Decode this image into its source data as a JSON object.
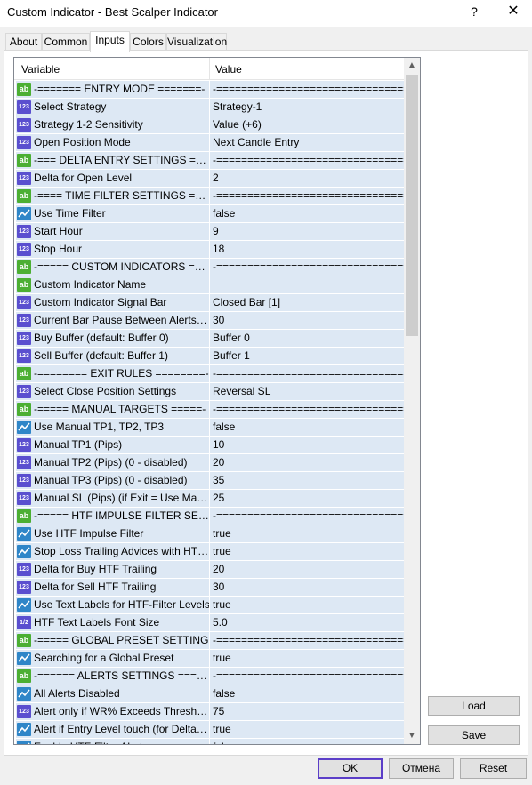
{
  "window": {
    "title": "Custom Indicator - Best Scalper Indicator",
    "help_glyph": "?",
    "close_glyph": "✕"
  },
  "tabs": [
    {
      "label": "About"
    },
    {
      "label": "Common"
    },
    {
      "label": "Inputs",
      "active": true
    },
    {
      "label": "Colors"
    },
    {
      "label": "Visualization"
    }
  ],
  "grid": {
    "header": {
      "variable": "Variable",
      "value": "Value"
    },
    "rows": [
      {
        "type": "ab",
        "variable": "-=======  ENTRY MODE  =======-",
        "value": "-===================================-"
      },
      {
        "type": "123",
        "variable": "Select Strategy",
        "value": "Strategy-1"
      },
      {
        "type": "123",
        "variable": "Strategy 1-2 Sensitivity",
        "value": "Value (+6)"
      },
      {
        "type": "123",
        "variable": "Open Position Mode",
        "value": "Next Candle Entry"
      },
      {
        "type": "ab",
        "variable": "-=== DELTA ENTRY SETTINGS ===-",
        "value": "-===================================-"
      },
      {
        "type": "123",
        "variable": "Delta for Open Level",
        "value": "2"
      },
      {
        "type": "ab",
        "variable": "-==== TIME FILTER SETTINGS ====-",
        "value": "-===================================-"
      },
      {
        "type": "bool",
        "variable": "Use Time Filter",
        "value": "false"
      },
      {
        "type": "123",
        "variable": "Start Hour",
        "value": "9"
      },
      {
        "type": "123",
        "variable": "Stop Hour",
        "value": "18"
      },
      {
        "type": "ab",
        "variable": "-=====  CUSTOM INDICATORS  =====-",
        "value": "-===================================-"
      },
      {
        "type": "ab",
        "variable": "Custom Indicator Name",
        "value": ""
      },
      {
        "type": "123",
        "variable": "Custom Indicator Signal Bar",
        "value": "Closed Bar [1]"
      },
      {
        "type": "123",
        "variable": "Current Bar Pause Between Alerts (Sec)",
        "value": "30"
      },
      {
        "type": "123",
        "variable": "Buy Buffer (default: Buffer 0)",
        "value": "Buffer 0"
      },
      {
        "type": "123",
        "variable": "Sell Buffer (default: Buffer 1)",
        "value": "Buffer 1"
      },
      {
        "type": "ab",
        "variable": "-========  EXIT RULES  ========-",
        "value": "-===================================-"
      },
      {
        "type": "123",
        "variable": "Select Close Position Settings",
        "value": "Reversal SL"
      },
      {
        "type": "ab",
        "variable": "-=====  MANUAL TARGETS  =====-",
        "value": "-===================================-"
      },
      {
        "type": "bool",
        "variable": "Use Manual TP1, TP2, TP3",
        "value": "false"
      },
      {
        "type": "123",
        "variable": "Manual TP1 (Pips)",
        "value": "10"
      },
      {
        "type": "123",
        "variable": "Manual TP2 (Pips) (0 - disabled)",
        "value": "20"
      },
      {
        "type": "123",
        "variable": "Manual TP3 (Pips) (0 - disabled)",
        "value": "35"
      },
      {
        "type": "123",
        "variable": "Manual SL (Pips) (if Exit = Use Manual SL)",
        "value": "25"
      },
      {
        "type": "ab",
        "variable": "-=====  HTF IMPULSE FILTER SETTINGS",
        "value": "-===================================-"
      },
      {
        "type": "bool",
        "variable": "Use HTF Impulse Filter",
        "value": "true"
      },
      {
        "type": "bool",
        "variable": "Stop Loss Trailing Advices with HTF-Filter",
        "value": "true"
      },
      {
        "type": "123",
        "variable": "Delta for Buy HTF Trailing",
        "value": "20"
      },
      {
        "type": "123",
        "variable": "Delta for Sell HTF Trailing",
        "value": "30"
      },
      {
        "type": "bool",
        "variable": "Use Text Labels for HTF-Filter Levels",
        "value": "true"
      },
      {
        "type": "dbl",
        "variable": "HTF Text Labels Font Size",
        "value": "5.0"
      },
      {
        "type": "ab",
        "variable": "-=====  GLOBAL PRESET SETTING",
        "value": "-===================================-"
      },
      {
        "type": "bool",
        "variable": "Searching for a Global Preset",
        "value": "true"
      },
      {
        "type": "ab",
        "variable": "-======  ALERTS SETTINGS  ======-",
        "value": "-===================================-"
      },
      {
        "type": "bool",
        "variable": "All Alerts Disabled",
        "value": "false"
      },
      {
        "type": "123",
        "variable": "Alert only if WR% Exceeds Threshold",
        "value": "75"
      },
      {
        "type": "bool",
        "variable": "Alert if Entry Level touch (for Delta Entry)",
        "value": "true"
      },
      {
        "type": "bool",
        "variable": "Enable HTF-Filter Alerts",
        "value": "false"
      }
    ]
  },
  "scrollbar": {
    "up_glyph": "▲",
    "down_glyph": "▼"
  },
  "side_buttons": {
    "load": "Load",
    "save": "Save"
  },
  "footer": {
    "ok": "OK",
    "cancel": "Отмена",
    "reset": "Reset"
  },
  "icons": {
    "ab": "ab",
    "123": "123",
    "dbl": "1/2"
  }
}
